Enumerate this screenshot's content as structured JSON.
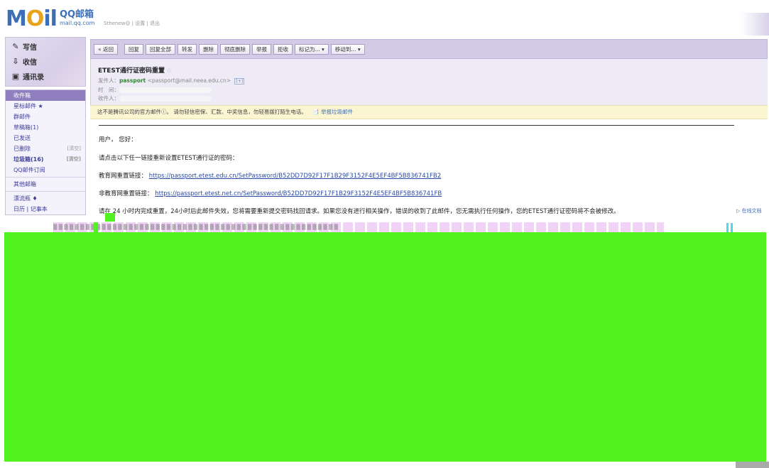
{
  "header": {
    "logo_mail": "MOil",
    "logo_cn": "QQ邮箱",
    "logo_domain": "mail.qq.com",
    "user_line": "Sthenew@ | 设置 | 退出"
  },
  "sidebar": {
    "quick": [
      {
        "icon": "pencil-icon",
        "label": "写信"
      },
      {
        "icon": "inbox-icon",
        "label": "收信"
      },
      {
        "icon": "contacts-icon",
        "label": "通讯录"
      }
    ],
    "folders": [
      {
        "label": "收件箱",
        "active": true
      },
      {
        "label": "星标邮件 ★"
      },
      {
        "label": "群邮件"
      },
      {
        "label": "草稿箱(1)"
      },
      {
        "label": "已发送"
      },
      {
        "label": "已删除",
        "clear": "[清空]"
      },
      {
        "label": "垃圾箱(16)",
        "clear": "[清空]",
        "bold": true
      },
      {
        "label": "QQ邮件订阅"
      },
      {
        "label": "其他邮箱"
      },
      {
        "label": "漂流瓶 ♦"
      },
      {
        "label": "日历 | 记事本"
      }
    ]
  },
  "toolbar": {
    "buttons": [
      "« 返回",
      "回复",
      "回复全部",
      "转发",
      "删除",
      "彻底删除",
      "举报",
      "拒收",
      "标记为... ▾",
      "移动到... ▾"
    ]
  },
  "mail": {
    "subject": "ETEST通行证密码重置",
    "star": "☆",
    "from_label": "发件人：",
    "from_name": "passport",
    "from_addr": "<passport@mail.neea.edu.cn>",
    "from_icon": "[+]",
    "time_label": "时　间：",
    "to_label": "收件人：",
    "warning": "这不是腾讯公司的官方邮件ⓘ。 请勿轻信密保、汇款、中奖信息，勿轻易拨打陌生电话。",
    "report": "📑 举报垃圾邮件",
    "greeting": "用户， 您好：",
    "instruction": "请点击以下任一链接重新设置ETEST通行证的密码：",
    "link1_label": "教育网重置链接：",
    "link1_url": "https://passport.etest.edu.cn/SetPassword/B52DD7D92F17F1B29F3152F4E5EF4BF5B836741FB2",
    "link2_label": "非教育网重置链接：",
    "link2_url": "https://passport.etest.net.cn/SetPassword/B52DD7D92F17F1B29F3152F4E5EF4BF5B836741FB",
    "notice": "请在 24 小时内完成重置，24小时后此邮件失效，您将需要重新提交密码找回请求。如果您没有进行相关操作，错误的收到了此邮件，您无需执行任何操作，您的ETEST通行证密码将不会被修改。",
    "side_link": "▷ 在线文档"
  },
  "glitch_text": "▒ ▒ ▒ ▒ ▒ ▒ ▒ ▒ ▒ ▒ ▒ ▒ ▒ ▒ ▒ ▒ ▒ ▒ ▒ ▒ ▒ ▒ ▒ ▒ ▒ ▒ ▒ ▒ ▒ ▒ ▒ ▒ ▒ ▒ ▒ ▒ ▒ ▒ ▒ ▒ ▒ ▒ ▒ ▒ ▒ ▒ ▒ ▒ ▒ ▒ ▒ ▒ ▒",
  "colors": {
    "accent": "#8f7fbf",
    "toolbar": "#d3cbe6",
    "warning_bg": "#fbf5d2",
    "glitch_green": "#52f221"
  }
}
